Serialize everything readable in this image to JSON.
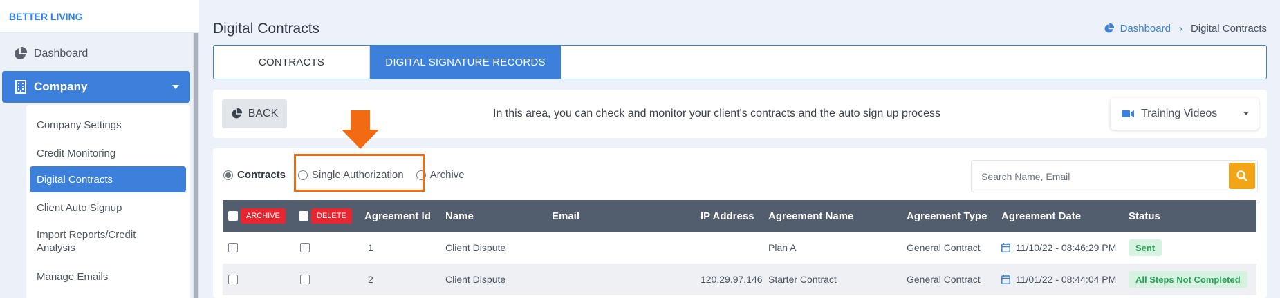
{
  "brand": "BETTER LIVING",
  "sidebar": {
    "dashboard": "Dashboard",
    "company": "Company",
    "submenu": [
      {
        "label": "Company Settings"
      },
      {
        "label": "Credit Monitoring"
      },
      {
        "label": "Digital Contracts"
      },
      {
        "label": "Client Auto Signup"
      },
      {
        "label": "Import Reports/Credit Analysis"
      },
      {
        "label": "Manage Emails"
      }
    ],
    "active_item": "Digital Contracts"
  },
  "page_title": "Digital Contracts",
  "breadcrumb": {
    "home": "Dashboard",
    "current": "Digital Contracts"
  },
  "tabs": [
    {
      "label": "CONTRACTS"
    },
    {
      "label": "DIGITAL SIGNATURE RECORDS"
    }
  ],
  "info_bar": {
    "back": "BACK",
    "text": "In this area, you can check and monitor your client's contracts and the auto sign up process",
    "training": "Training Videos"
  },
  "filters": {
    "contracts": "Contracts",
    "single": "Single Authorization",
    "archive": "Archive",
    "selected": "Contracts"
  },
  "search": {
    "placeholder": "Search Name, Email"
  },
  "table": {
    "archive_btn": "ARCHIVE",
    "delete_btn": "DELETE",
    "headers": {
      "id": "Agreement Id",
      "name": "Name",
      "email": "Email",
      "ip": "IP Address",
      "agreement": "Agreement Name",
      "type": "Agreement Type",
      "date": "Agreement Date",
      "status": "Status"
    },
    "rows": [
      {
        "id": "1",
        "name": "Client Dispute",
        "email": "",
        "ip": "",
        "agreement": "Plan A",
        "type": "General Contract",
        "date": "11/10/22 - 08:46:29 PM",
        "status": "Sent"
      },
      {
        "id": "2",
        "name": "Client Dispute",
        "email": "",
        "ip": "120.29.97.146",
        "agreement": "Starter Contract",
        "type": "General Contract",
        "date": "11/01/22 - 08:44:04 PM",
        "status": "All Steps Not Completed"
      }
    ]
  },
  "colors": {
    "primary": "#3c80dc",
    "highlight": "#f26b12",
    "danger": "#e8262f",
    "search_btn": "#f2a516",
    "header_bg": "#525d6e"
  }
}
